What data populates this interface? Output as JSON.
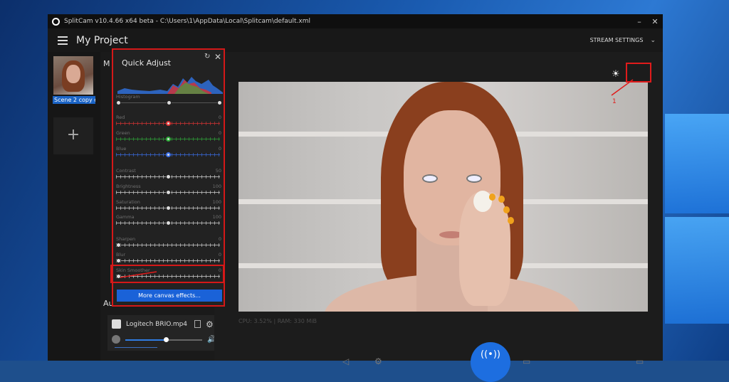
{
  "app": {
    "window_title": "SplitCam v10.4.66 x64 beta - C:\\Users\\1\\AppData\\Local\\Splitcam\\default.xml",
    "project_title": "My Project",
    "stream_settings_label": "STREAM SETTINGS"
  },
  "scenes": {
    "items": [
      {
        "label": "Scene 2 copy c"
      }
    ],
    "add_label": "+"
  },
  "mid": {
    "media_label": "M",
    "audio_label": "Au"
  },
  "audio": {
    "device_name": "Logitech BRIO.mp4",
    "volume_fraction": 0.53
  },
  "preview": {
    "stats": "CPU: 3.52% | RAM: 330 MiB"
  },
  "annotation": {
    "marker_label": "1"
  },
  "quick_adjust": {
    "title": "Quick Adjust",
    "histogram_label": "Histogram",
    "histogram_levels": [
      0.0,
      0.5,
      1.0
    ],
    "sliders": [
      {
        "label": "Red",
        "value": "0",
        "fraction": 0.5,
        "color": "#e03434"
      },
      {
        "label": "Green",
        "value": "0",
        "fraction": 0.5,
        "color": "#2fae3a"
      },
      {
        "label": "Blue",
        "value": "0",
        "fraction": 0.5,
        "color": "#3a6fe8"
      },
      {
        "label": "Contrast",
        "value": "50",
        "fraction": 0.5,
        "color": "#dddddd"
      },
      {
        "label": "Brightness",
        "value": "100",
        "fraction": 0.5,
        "color": "#dddddd"
      },
      {
        "label": "Saturation",
        "value": "100",
        "fraction": 0.5,
        "color": "#dddddd"
      },
      {
        "label": "Gamma",
        "value": "100",
        "fraction": 0.5,
        "color": "#dddddd"
      },
      {
        "label": "Sharpen",
        "value": "0",
        "fraction": 0.0,
        "color": "#dddddd"
      },
      {
        "label": "Blur",
        "value": "0",
        "fraction": 0.0,
        "color": "#dddddd"
      },
      {
        "label": "Skin Smoother",
        "value": "0",
        "fraction": 0.0,
        "color": "#dddddd"
      }
    ],
    "more_button": "More canvas effects..."
  },
  "colors": {
    "accent": "#1a62d8",
    "annotation": "#e01b1b"
  }
}
